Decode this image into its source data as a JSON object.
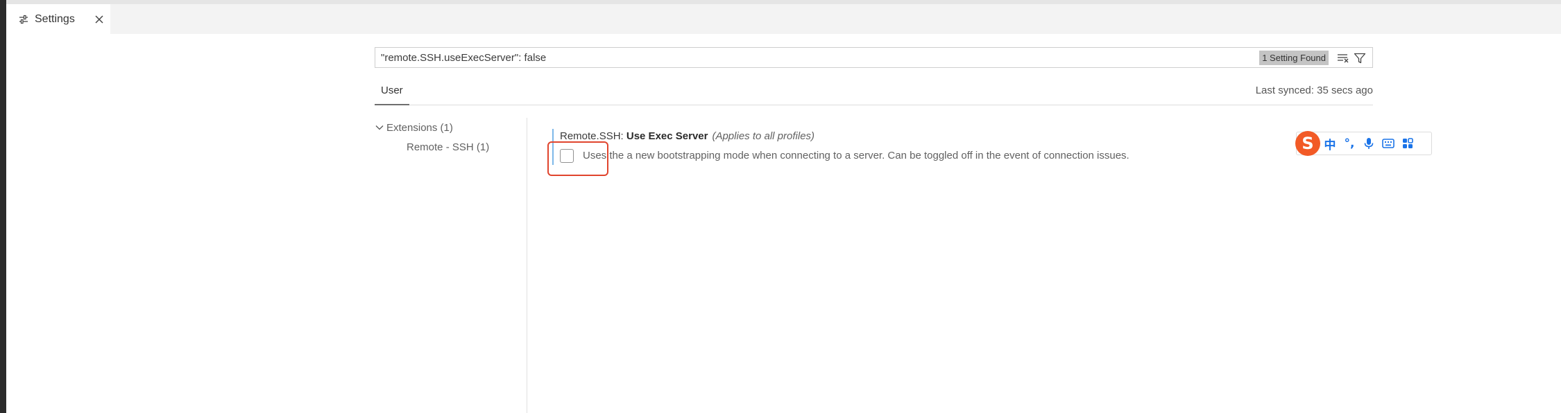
{
  "tab": {
    "label": "Settings"
  },
  "search": {
    "query": "\"remote.SSH.useExecServer\": false",
    "found_label": "1 Setting Found"
  },
  "scope_tabs": {
    "user_label": "User",
    "last_synced": "Last synced: 35 secs ago"
  },
  "toc": {
    "extensions_label": "Extensions (1)",
    "remote_ssh_label": "Remote - SSH (1)"
  },
  "setting": {
    "category": "Remote.SSH: ",
    "name": "Use Exec Server",
    "scope_note": "(Applies to all profiles)",
    "description": "Uses the a new bootstrapping mode when connecting to a server. Can be toggled off in the event of connection issues.",
    "checked": false
  },
  "ime": {
    "logo_text": "S",
    "items": [
      "中",
      "°,",
      "mic",
      "keyboard",
      "apps"
    ],
    "lang_label": "中",
    "punct_label": "°,"
  },
  "colors": {
    "highlight": "#e0442d",
    "ime_brand": "#f25a26",
    "ime_icon": "#1a73e8"
  }
}
